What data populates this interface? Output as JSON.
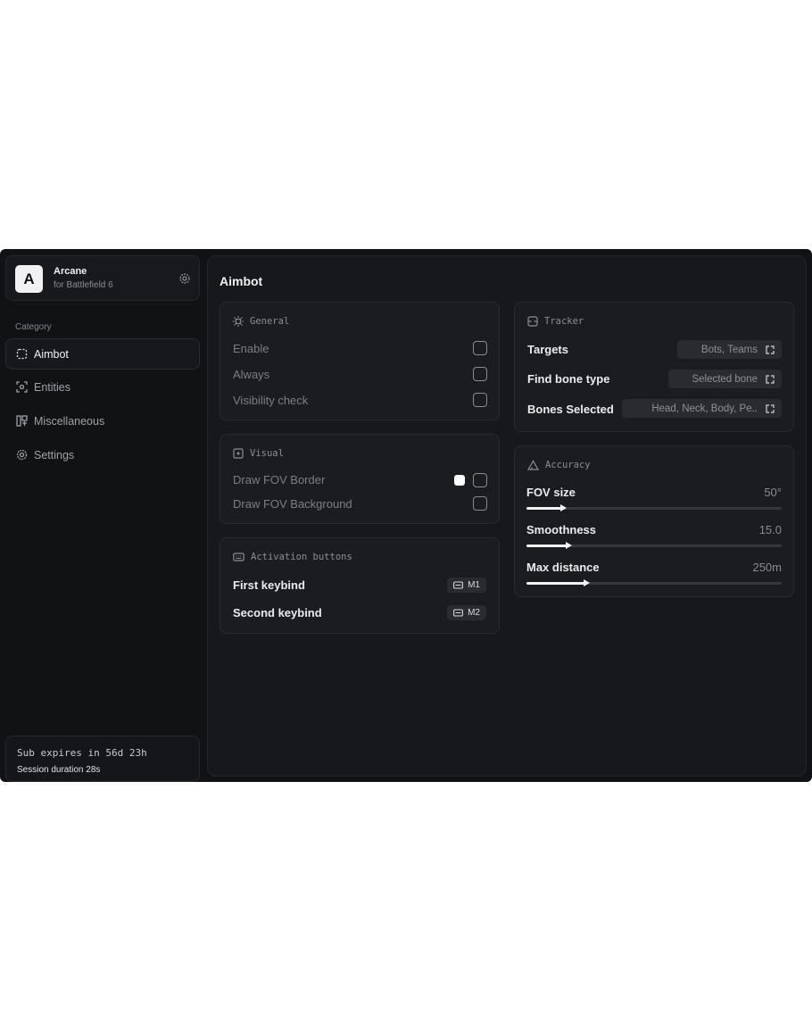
{
  "app": {
    "logo_letter": "A",
    "name": "Arcane",
    "subtitle": "for Battlefield 6"
  },
  "sidebar": {
    "category_label": "Category",
    "items": [
      {
        "label": "Aimbot",
        "icon": "crosshair-dashed-icon",
        "active": true
      },
      {
        "label": "Entities",
        "icon": "entity-scan-icon",
        "active": false
      },
      {
        "label": "Miscellaneous",
        "icon": "misc-grid-icon",
        "active": false
      },
      {
        "label": "Settings",
        "icon": "gear-icon",
        "active": false
      }
    ],
    "subscription": {
      "expires": "Sub expires in 56d 23h",
      "session": "Session duration 28s"
    }
  },
  "main": {
    "title": "Aimbot",
    "general": {
      "title": "General",
      "rows": [
        {
          "label": "Enable",
          "checked": false
        },
        {
          "label": "Always",
          "checked": false
        },
        {
          "label": "Visibility check",
          "checked": false
        }
      ]
    },
    "visual": {
      "title": "Visual",
      "rows": [
        {
          "label": "Draw FOV Border",
          "checked": false,
          "color": "#ffffff"
        },
        {
          "label": "Draw FOV Background",
          "checked": false
        }
      ]
    },
    "activation": {
      "title": "Activation buttons",
      "rows": [
        {
          "label": "First keybind",
          "key": "M1"
        },
        {
          "label": "Second keybind",
          "key": "M2"
        }
      ]
    },
    "tracker": {
      "title": "Tracker",
      "rows": [
        {
          "label": "Targets",
          "value": "Bots, Teams"
        },
        {
          "label": "Find bone type",
          "value": "Selected bone"
        },
        {
          "label": "Bones Selected",
          "value": "Head, Neck, Body, Pe.."
        }
      ]
    },
    "accuracy": {
      "title": "Accuracy",
      "sliders": [
        {
          "label": "FOV size",
          "value": "50°",
          "fraction": 0.14
        },
        {
          "label": "Smoothness",
          "value": "15.0",
          "fraction": 0.16
        },
        {
          "label": "Max distance",
          "value": "250m",
          "fraction": 0.23
        }
      ]
    }
  }
}
